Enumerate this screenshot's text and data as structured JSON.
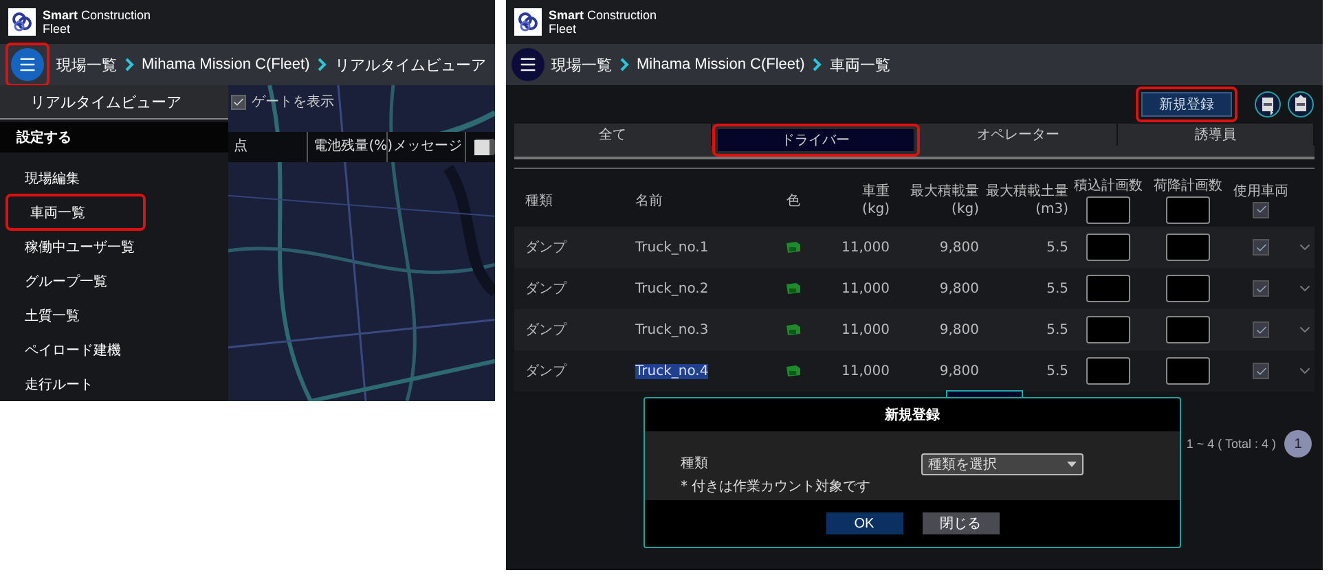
{
  "left_screen": {
    "header": {
      "brand_line1": "**Smart** Construction",
      "brand_line2": "Fleet"
    },
    "menu_button": {
      "annotated": true
    },
    "breadcrumb": [
      "現場一覧",
      "Mihama Mission C(Fleet)",
      "リアルタイムビューア"
    ],
    "map_toolbar": {
      "gate_label": "ゲートを表示",
      "gate_checked": true
    },
    "table_header": [
      "点",
      "電池残量(%)",
      "メッセージ"
    ],
    "table_toggle_on": false,
    "menu": {
      "current": "リアルタイムビューア",
      "section": "設定する",
      "items": [
        {
          "label": "現場編集",
          "annotated": false
        },
        {
          "label": "車両一覧",
          "annotated": true
        },
        {
          "label": "稼働中ユーザ一覧",
          "annotated": false
        },
        {
          "label": "グループ一覧",
          "annotated": false
        },
        {
          "label": "土質一覧",
          "annotated": false
        },
        {
          "label": "ペイロード建機",
          "annotated": false
        },
        {
          "label": "走行ルート",
          "annotated": false
        }
      ]
    }
  },
  "right_screen": {
    "header": {
      "brand_line1": "**Smart** Construction",
      "brand_line2": "Fleet"
    },
    "menu_button": {
      "annotated": false
    },
    "breadcrumb": [
      "現場一覧",
      "Mihama Mission C(Fleet)",
      "車両一覧"
    ],
    "new_button": {
      "label": "新規登録",
      "annotated": true
    },
    "tabs": [
      {
        "label": "全て",
        "selected": false,
        "annotated": false
      },
      {
        "label": "ドライバー",
        "selected": true,
        "annotated": true
      },
      {
        "label": "オペレーター",
        "selected": false,
        "annotated": false
      },
      {
        "label": "誘導員",
        "selected": false,
        "annotated": false
      }
    ],
    "columns": [
      {
        "label": "種類",
        "kind": "text"
      },
      {
        "label": "名前",
        "kind": "text"
      },
      {
        "label": "色",
        "kind": "center"
      },
      {
        "label": "車重",
        "unit": "(kg)",
        "kind": "number"
      },
      {
        "label": "最大積載量",
        "unit": "(kg)",
        "kind": "number"
      },
      {
        "label": "最大積載土量",
        "unit": "(m3)",
        "kind": "number"
      },
      {
        "label": "積込計画数",
        "kind": "input"
      },
      {
        "label": "荷降計画数",
        "kind": "input"
      },
      {
        "label": "使用車両",
        "kind": "checkbox",
        "checked": true
      }
    ],
    "rows": [
      {
        "type": "ダンプ",
        "name": "Truck_no.1",
        "name_highlighted": false,
        "weight": "11,000",
        "max_load": "9,800",
        "max_volume": "5.5",
        "in_use": true
      },
      {
        "type": "ダンプ",
        "name": "Truck_no.2",
        "name_highlighted": false,
        "weight": "11,000",
        "max_load": "9,800",
        "max_volume": "5.5",
        "in_use": true
      },
      {
        "type": "ダンプ",
        "name": "Truck_no.3",
        "name_highlighted": false,
        "weight": "11,000",
        "max_load": "9,800",
        "max_volume": "5.5",
        "in_use": true
      },
      {
        "type": "ダンプ",
        "name": "Truck_no.4",
        "name_highlighted": true,
        "weight": "11,000",
        "max_load": "9,800",
        "max_volume": "5.5",
        "in_use": true
      }
    ],
    "pagination": {
      "range": "1 ~ 4 ( Total : 4 )",
      "pages": [
        {
          "label": "1",
          "selected": true
        }
      ]
    },
    "modal": {
      "title": "新規登録",
      "field_label": "種類",
      "note": "* 付きは作業カウント対象です",
      "select_value": "種類を選択",
      "buttons": [
        {
          "label": "OK",
          "kind": "primary"
        },
        {
          "label": "閉じる",
          "kind": "secondary"
        }
      ]
    }
  }
}
